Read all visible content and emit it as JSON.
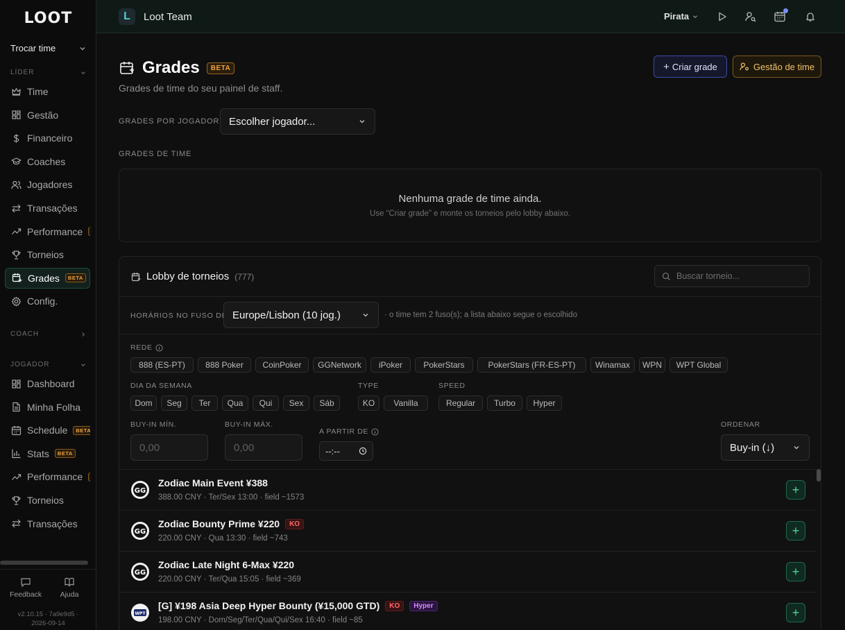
{
  "sidebar": {
    "logo": "LOOT",
    "team_switch": "Trocar time",
    "sections": {
      "leader": "LÍDER",
      "coach": "COACH",
      "player": "JOGADOR"
    },
    "leader_items": [
      {
        "label": "Time",
        "icon": "crown-icon"
      },
      {
        "label": "Gestão",
        "icon": "grid-icon"
      },
      {
        "label": "Financeiro",
        "icon": "dollar-icon"
      },
      {
        "label": "Coaches",
        "icon": "graduation-cap-icon"
      },
      {
        "label": "Jogadores",
        "icon": "users-icon"
      },
      {
        "label": "Transações",
        "icon": "arrows-icon"
      },
      {
        "label": "Performance",
        "icon": "trend-icon",
        "badge": "BETA"
      },
      {
        "label": "Torneios",
        "icon": "trophy-icon"
      },
      {
        "label": "Grades",
        "icon": "calendar-plus-icon",
        "badge": "BETA"
      },
      {
        "label": "Config.",
        "icon": "gear-icon"
      }
    ],
    "player_items": [
      {
        "label": "Dashboard",
        "icon": "grid-icon"
      },
      {
        "label": "Minha Folha",
        "icon": "file-icon"
      },
      {
        "label": "Schedule",
        "icon": "calendar-icon",
        "badge": "BETA"
      },
      {
        "label": "Stats",
        "icon": "bar-chart-icon",
        "badge": "BETA"
      },
      {
        "label": "Performance",
        "icon": "trend-icon",
        "badge": "BETA"
      },
      {
        "label": "Torneios",
        "icon": "trophy-icon"
      },
      {
        "label": "Transações",
        "icon": "arrows-icon"
      }
    ],
    "footer": {
      "feedback": "Feedback",
      "help": "Ajuda",
      "version": "v2.10.15 · 7a9e9d5 ·",
      "date": "2026-09-14"
    }
  },
  "topbar": {
    "team_initial": "L",
    "team_name": "Loot Team",
    "user": "Pirata"
  },
  "page": {
    "title": "Grades",
    "badge": "BETA",
    "subtitle": "Grades de time do seu painel de staff.",
    "create_button": "Criar grade",
    "manage_button": "Gestão de time",
    "by_player_label": "GRADES POR JOGADOR",
    "player_select": "Escolher jogador...",
    "team_grades_label": "GRADES DE TIME",
    "empty_title": "Nenhuma grade de time ainda.",
    "empty_sub": "Use “Criar grade” e monte os torneios pelo lobby abaixo."
  },
  "lobby": {
    "title": "Lobby de torneios",
    "count": "(777)",
    "search_placeholder": "Buscar torneio...",
    "tz_label": "HORÁRIOS NO FUSO DE",
    "tz_value": "Europe/Lisbon (10 jog.)",
    "tz_note": "· o time tem 2 fuso(s); a lista abaixo segue o escolhido",
    "network_label": "REDE",
    "networks": [
      "888 (ES-PT)",
      "888 Poker",
      "CoinPoker",
      "GGNetwork",
      "iPoker",
      "PokerStars",
      "PokerStars (FR-ES-PT)",
      "Winamax",
      "WPN",
      "WPT Global"
    ],
    "day_label": "DIA DA SEMANA",
    "days": [
      "Dom",
      "Seg",
      "Ter",
      "Qua",
      "Qui",
      "Sex",
      "Sáb"
    ],
    "type_label": "TYPE",
    "types": [
      "KO",
      "Vanilla"
    ],
    "speed_label": "SPEED",
    "speeds": [
      "Regular",
      "Turbo",
      "Hyper"
    ],
    "buyin_min_label": "BUY-IN MÍN.",
    "buyin_max_label": "BUY-IN MÁX.",
    "buyin_min_placeholder": "0,00",
    "buyin_max_placeholder": "0,00",
    "from_label": "A PARTIR DE",
    "from_value": "--:--",
    "order_label": "ORDENAR",
    "order_value": "Buy-in (↓)",
    "tournaments": [
      {
        "name": "Zodiac Main Event ¥388",
        "meta": "388.00 CNY · Ter/Sex 13:00 · field ~1573",
        "tags": [],
        "network": "GG"
      },
      {
        "name": "Zodiac Bounty Prime ¥220",
        "meta": "220.00 CNY · Qua 13:30 · field ~743",
        "tags": [
          "KO"
        ],
        "network": "GG"
      },
      {
        "name": "Zodiac Late Night 6-Max ¥220",
        "meta": "220.00 CNY · Ter/Qua 15:05 · field ~369",
        "tags": [],
        "network": "GG"
      },
      {
        "name": "[G] ¥198 Asia Deep Hyper Bounty (¥15,000 GTD)",
        "meta": "198.00 CNY · Dom/Seg/Ter/Qua/Qui/Sex 16:40 · field ~85",
        "tags": [
          "KO",
          "Hyper"
        ],
        "network": "WPT"
      }
    ]
  }
}
